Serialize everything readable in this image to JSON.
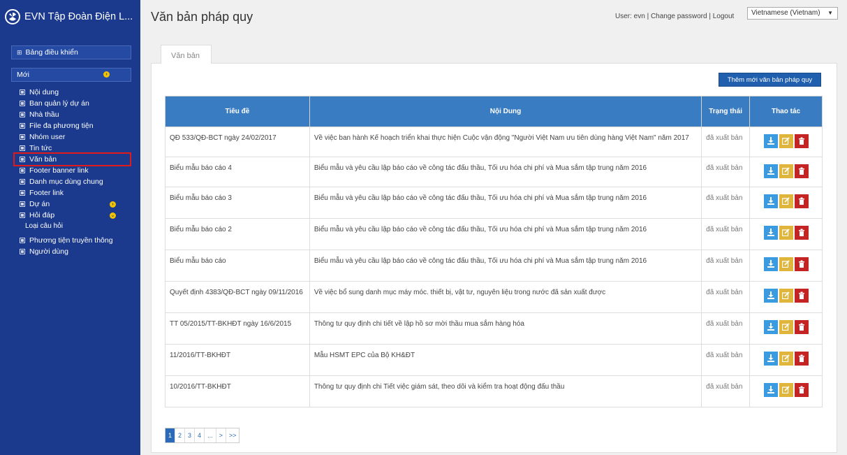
{
  "brand": {
    "title": "EVN Tập Đoàn Điện L..."
  },
  "sidebar": {
    "dashboard": "Bảng điều khiển",
    "new": "Mới",
    "items": [
      {
        "label": "Nội dung",
        "icon": "doc-icon"
      },
      {
        "label": "Ban quản lý dự án",
        "icon": "square-icon"
      },
      {
        "label": "Nhà thầu",
        "icon": "square-icon"
      },
      {
        "label": "File đa phương tiện",
        "icon": "square-icon"
      },
      {
        "label": "Nhóm user",
        "icon": "square-icon"
      },
      {
        "label": "Tin tức",
        "icon": "square-icon"
      },
      {
        "label": "Văn bản",
        "icon": "square-icon"
      },
      {
        "label": "Footer banner link",
        "icon": "square-icon"
      },
      {
        "label": "Danh mục dùng chung",
        "icon": "square-icon"
      },
      {
        "label": "Footer link",
        "icon": "square-icon"
      },
      {
        "label": "Dự án",
        "icon": "square-icon"
      },
      {
        "label": "Hỏi đáp",
        "icon": "square-icon"
      },
      {
        "label": "Loại câu hỏi"
      },
      {
        "label": "Phương tiện truyền thông",
        "icon": "image-icon"
      },
      {
        "label": "Người dùng",
        "icon": "user-icon"
      }
    ]
  },
  "header": {
    "title": "Văn bản pháp quy",
    "user_prefix": "User: ",
    "user": "evn",
    "sep": " | ",
    "change_password": "Change password",
    "logout": "Logout",
    "language": "Vietnamese (Vietnam)"
  },
  "tab": {
    "label": "Văn bản"
  },
  "add_button": "Thêm mới văn bản pháp quy",
  "table": {
    "headers": [
      "Tiêu đề",
      "Nội Dung",
      "Trạng thái",
      "Thao tác"
    ],
    "rows": [
      {
        "title": "QĐ 533/QĐ-BCT ngày 24/02/2017",
        "content": "Về việc ban hành Kế hoạch triển khai thực hiện Cuộc vận động \"Người Việt Nam ưu tiên dùng hàng Việt Nam\" năm 2017",
        "status": "đã xuất bản"
      },
      {
        "title": "Biểu mẫu báo cáo 4",
        "content": "Biểu mẫu và yêu cầu lập báo cáo về công tác đấu thầu, Tối ưu hóa chi phí và Mua sắm tập trung năm 2016",
        "status": "đã xuất bản"
      },
      {
        "title": "Biểu mẫu báo cáo 3",
        "content": "Biểu mẫu và yêu cầu lập báo cáo về công tác đấu thầu, Tối ưu hóa chi phí và Mua sắm tập trung năm 2016",
        "status": "đã xuất bản"
      },
      {
        "title": "Biểu mẫu báo cáo 2",
        "content": "Biểu mẫu và yêu cầu lập báo cáo về công tác đấu thầu, Tối ưu hóa chi phí và Mua sắm tập trung năm 2016",
        "status": "đã xuất bản"
      },
      {
        "title": "Biểu mẫu báo cáo",
        "content": "Biểu mẫu và yêu cầu lập báo cáo về công tác đấu thầu, Tối ưu hóa chi phí và Mua sắm tập trung năm 2016",
        "status": "đã xuất bản"
      },
      {
        "title": "Quyết định 4383/QĐ-BCT ngày 09/11/2016",
        "content": "Về việc bổ sung danh mục máy móc. thiết bị, vật tư, nguyên liệu trong nước đã sản xuất được",
        "status": "đã xuất bản"
      },
      {
        "title": "TT 05/2015/TT-BKHĐT ngày 16/6/2015",
        "content": "Thông tư quy định chi tiết về lập hồ sơ mời thầu mua sắm hàng hóa",
        "status": "đã xuất bản"
      },
      {
        "title": "11/2016/TT-BKHĐT",
        "content": "Mẫu HSMT EPC của Bộ KH&ĐT",
        "status": "đã xuất bản"
      },
      {
        "title": "10/2016/TT-BKHĐT",
        "content": "Thông tư quy định chi Tiết việc giám sát, theo dõi và kiểm tra hoạt động đấu thầu",
        "status": "đã xuất bản"
      }
    ]
  },
  "pagination": [
    "1",
    "2",
    "3",
    "4",
    "...",
    ">",
    ">>"
  ],
  "colors": {
    "sidebar": "#1b3a8e",
    "header_row": "#3a7cc2",
    "download": "#3a9be0",
    "edit": "#e0b53c",
    "delete": "#c42424"
  }
}
